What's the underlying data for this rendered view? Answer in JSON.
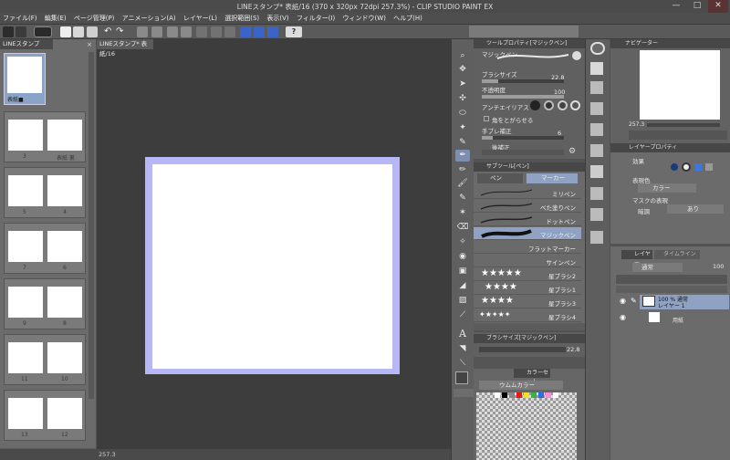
{
  "window": {
    "title": "LINEスタンプ* 表紙/16 (370 x 320px 72dpi 257.3%) - CLIP STUDIO PAINT EX",
    "min": "—",
    "max": "□",
    "close": "✕"
  },
  "menu": [
    "ファイル(F)",
    "編集(E)",
    "ページ管理(P)",
    "アニメーション(A)",
    "レイヤー(L)",
    "選択範囲(S)",
    "表示(V)",
    "フィルター(I)",
    "ウィンドウ(W)",
    "ヘルプ(H)"
  ],
  "pagelist": {
    "tab": "LINEスタンプ",
    "pages": [
      {
        "label": "表紙■",
        "selected": true
      },
      {
        "left": "3",
        "right": "表紙 裏"
      },
      {
        "left": "5",
        "right": "4"
      },
      {
        "left": "7",
        "right": "6"
      },
      {
        "left": "9",
        "right": "8"
      },
      {
        "left": "11",
        "right": "10"
      },
      {
        "left": "13",
        "right": "12"
      }
    ]
  },
  "canvas": {
    "tab": "LINEスタンプ* 表紙/16",
    "zoom": "257.3"
  },
  "toolprop": {
    "title": "ツールプロパティ[マジックペン]",
    "tool_name": "マジックペン",
    "brush_size_label": "ブラシサイズ",
    "brush_size_value": "22.8",
    "opacity_label": "不透明度",
    "opacity_value": "100",
    "antialias_label": "アンチエイリアス",
    "sharp_label": "角をとがらせる",
    "stabilize_label": "手ブレ補正",
    "stabilize_value": "6",
    "post_label": "後補正"
  },
  "subtool": {
    "title": "サブツール[ペン]",
    "tab_pen": "ペン",
    "tab_marker": "マーカー",
    "items": [
      {
        "label": "ミリペン"
      },
      {
        "label": "べた塗りペン"
      },
      {
        "label": "ドットペン"
      },
      {
        "label": "マジックペン",
        "selected": true
      },
      {
        "label": "フラットマーカー"
      },
      {
        "label": "サインペン"
      },
      {
        "label": "星ブラシ2"
      },
      {
        "label": "星ブラシ1"
      },
      {
        "label": "星ブラシ3"
      },
      {
        "label": "星ブラシ4"
      }
    ]
  },
  "brushsize": {
    "title": "ブラシサイズ[マジックペン]",
    "value": "22.8"
  },
  "colorset": {
    "tab": "カラーセット",
    "name": "ウムムカラー",
    "colors": [
      "#ffffff",
      "#000000",
      "#888888",
      "#e41a1a",
      "#f0e020",
      "#3cb043",
      "#2b6fe0",
      "#ff8ad8",
      "#ffffff"
    ]
  },
  "navigator": {
    "title": "ナビゲーター",
    "zoom": "257.3"
  },
  "layerprop": {
    "title": "レイヤープロパティ",
    "effect": "効果",
    "display_color": "表現色",
    "color_value": "カラー",
    "mask_expr": "マスクの表現",
    "dim_label": "暗調",
    "dim_value": "あり"
  },
  "layers": {
    "tab": "レイヤー",
    "tab2": "タイムライン",
    "blend": "通常",
    "opacity": "100",
    "items": [
      {
        "top": "100 % 通常",
        "name": "レイヤー 1",
        "selected": true
      },
      {
        "name": "用紙"
      }
    ]
  },
  "colors": {
    "canvas_border": "#b7b6f6",
    "selection": "#8fa2c4"
  }
}
